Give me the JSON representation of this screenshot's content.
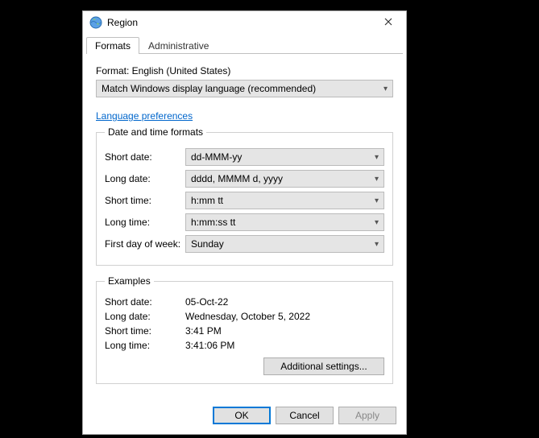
{
  "window": {
    "title": "Region"
  },
  "tabs": {
    "formats": "Formats",
    "administrative": "Administrative"
  },
  "format_section": {
    "label": "Format: English (United States)",
    "combo_value": "Match Windows display language (recommended)"
  },
  "language_preferences": "Language preferences",
  "datetime_formats": {
    "legend": "Date and time formats",
    "short_date_label": "Short date:",
    "short_date_value": "dd-MMM-yy",
    "long_date_label": "Long date:",
    "long_date_value": "dddd, MMMM d, yyyy",
    "short_time_label": "Short time:",
    "short_time_value": "h:mm tt",
    "long_time_label": "Long time:",
    "long_time_value": "h:mm:ss tt",
    "first_day_label": "First day of week:",
    "first_day_value": "Sunday"
  },
  "examples": {
    "legend": "Examples",
    "short_date_label": "Short date:",
    "short_date_value": "05-Oct-22",
    "long_date_label": "Long date:",
    "long_date_value": "Wednesday, October 5, 2022",
    "short_time_label": "Short time:",
    "short_time_value": "3:41 PM",
    "long_time_label": "Long time:",
    "long_time_value": "3:41:06 PM"
  },
  "buttons": {
    "additional": "Additional settings...",
    "ok": "OK",
    "cancel": "Cancel",
    "apply": "Apply"
  }
}
